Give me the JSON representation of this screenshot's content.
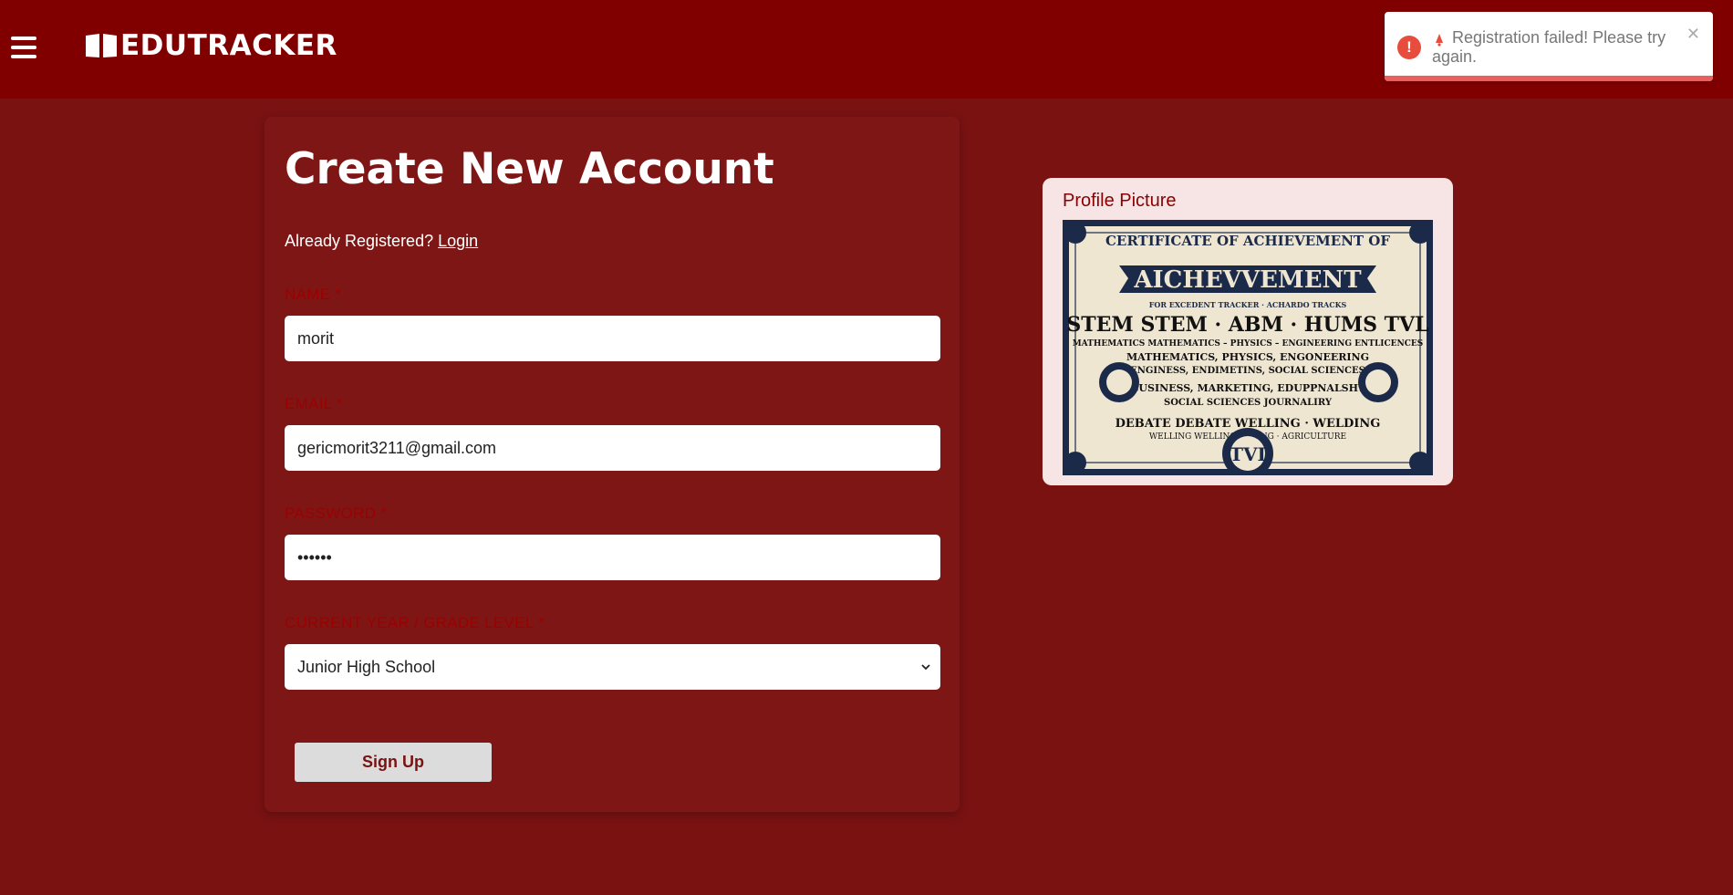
{
  "header": {
    "brand": "EDUTRACKER",
    "menu_icon": "hamburger-menu-icon",
    "logo_icon": "open-book-icon"
  },
  "form": {
    "title": "Create New Account",
    "already_text": "Already Registered?",
    "login_link": "Login",
    "name_label": "NAME *",
    "name_value": "morit",
    "email_label": "EMAIL *",
    "email_value": "gericmorit3211@gmail.com",
    "password_label": "PASSWORD *",
    "password_value": "••••••",
    "grade_label": "CURRENT YEAR / GRADE LEVEL *",
    "grade_selected": "Junior High School",
    "submit_label": "Sign Up"
  },
  "profile": {
    "label": "Profile Picture",
    "image_texts": {
      "header": "CERTIFICATE OF ACHIEVEMENT OF",
      "banner": "AICHEVVEMENT",
      "sub": "FOR EXCEDENT TRACKER · ACHARDO TRACKS",
      "tracks": "STEM STEM · ABM · HUMS TVL",
      "l1": "MATHEMATICS  MATHEMATICS – PHYSICS – ENGINEERING  ENTLICENCES",
      "l2": "MATHEMATICS, PHYSICS, ENGONEERING",
      "l3": "ENGINESS, ENDIMETINS, SOCIAL SCIENCES",
      "l4": "BUSINESS, MARKETING, EDUPPNALSHY",
      "l5": "SOCIAL SCIENCES     JOURNALIRY",
      "l6": "DEBATE  DEBATE   WELLING · WELDING",
      "l7": "WELLING  WELLING   ELDING · AGRICULTURE",
      "seal": "TVI"
    }
  },
  "toast": {
    "message": "Registration failed! Please try again.",
    "type_icon": "error-icon",
    "close_glyph": "✕"
  },
  "colors": {
    "header_bg": "#800000",
    "page_bg": "#7a1212",
    "card_bg": "#7f1616",
    "label_color": "#9b0000",
    "toast_accent": "#e74c3c"
  }
}
